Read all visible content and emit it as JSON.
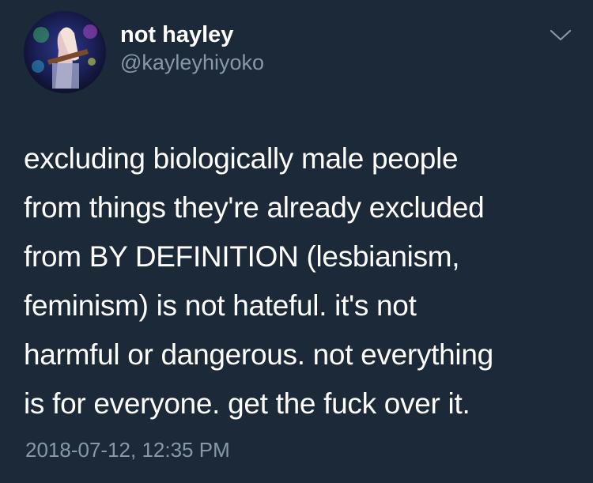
{
  "tweet": {
    "display_name": "not hayley",
    "handle": "@kayleyhiyoko",
    "menu_icon": "chevron-down-icon",
    "avatar_icon": "avatar-photo",
    "body_lines": [
      "excluding biologically male people",
      "from things they're already excluded",
      "from BY DEFINITION (lesbianism,",
      "feminism) is not hateful. it's not",
      "harmful or dangerous. not everything",
      "is for everyone. get the fuck over it."
    ],
    "timestamp": "2018-07-12, 12:35 PM"
  },
  "colors": {
    "background": "#1c2938",
    "text": "#ffffff",
    "secondary_text": "#8899a6"
  }
}
